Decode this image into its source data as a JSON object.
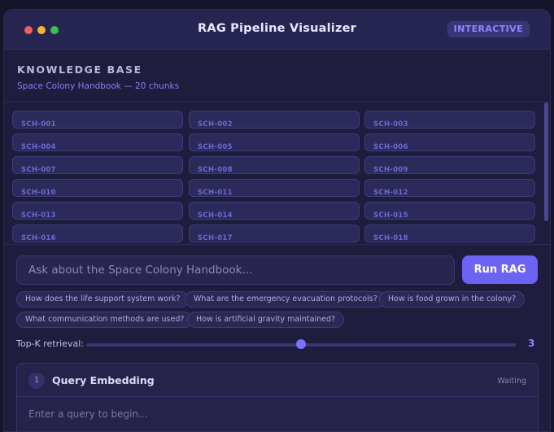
{
  "window": {
    "title": "RAG Pipeline Visualizer",
    "badge": "INTERACTIVE"
  },
  "knowledge_base": {
    "heading": "KNOWLEDGE BASE",
    "subtitle": "Space Colony Handbook — 20 chunks",
    "chunks": [
      "SCH-001",
      "SCH-002",
      "SCH-003",
      "SCH-004",
      "SCH-005",
      "SCH-006",
      "SCH-007",
      "SCH-008",
      "SCH-009",
      "SCH-010",
      "SCH-011",
      "SCH-012",
      "SCH-013",
      "SCH-014",
      "SCH-015",
      "SCH-016",
      "SCH-017",
      "SCH-018"
    ]
  },
  "query": {
    "placeholder": "Ask about the Space Colony Handbook...",
    "run_label": "Run RAG"
  },
  "suggestions": [
    "How does the life support system work?",
    "What are the emergency evacuation protocols?",
    "How is food grown in the colony?",
    "What communication methods are used?",
    "How is artificial gravity maintained?"
  ],
  "topk": {
    "label": "Top-K retrieval:",
    "value": "3",
    "slider_fraction": 0.5
  },
  "stage": {
    "number": "1",
    "title": "Query Embedding",
    "status": "Waiting",
    "body": "Enter a query to begin..."
  },
  "colors": {
    "accent": "#6c63f4",
    "background": "#1e1d3d",
    "traffic_red": "#f0605c",
    "traffic_yellow": "#f5b431",
    "traffic_green": "#36c24c"
  }
}
